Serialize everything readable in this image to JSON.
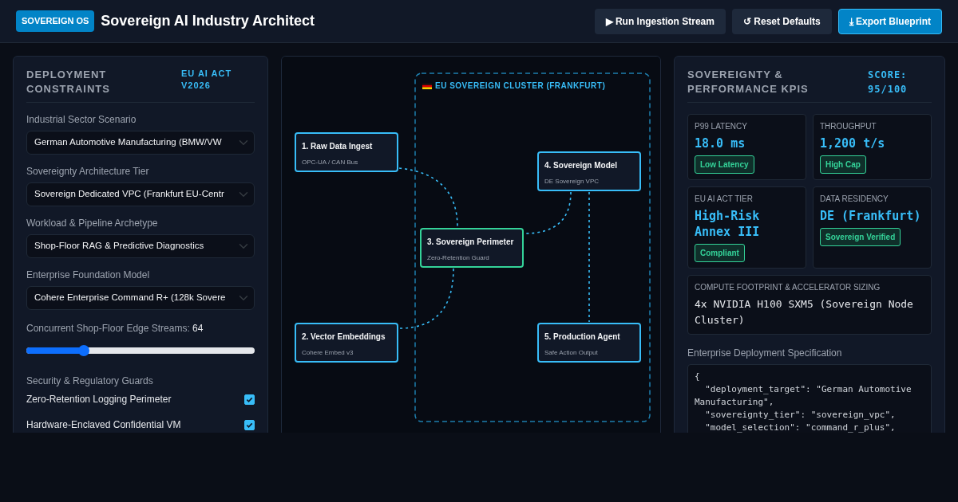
{
  "header": {
    "badge": "SOVEREIGN OS",
    "title": "Sovereign AI Industry Architect",
    "buttons": [
      {
        "label": "▶ Run Ingestion Stream",
        "kind": "secondary"
      },
      {
        "label": "↺ Reset Defaults",
        "kind": "secondary"
      },
      {
        "label": "⤓ Export Blueprint",
        "kind": "primary"
      }
    ]
  },
  "constraints": {
    "title": "DEPLOYMENT CONSTRAINTS",
    "tag": "EU AI ACT V2026",
    "selects": [
      {
        "label": "Industrial Sector Scenario",
        "value": "German Automotive Manufacturing (BMW/VW"
      },
      {
        "label": "Sovereignty Architecture Tier",
        "value": "Sovereign Dedicated VPC (Frankfurt EU-Centr"
      },
      {
        "label": "Workload & Pipeline Archetype",
        "value": "Shop-Floor RAG & Predictive Diagnostics"
      },
      {
        "label": "Enterprise Foundation Model",
        "value": "Cohere Enterprise Command R+ (128k Sovere"
      }
    ],
    "slider": {
      "label": "Concurrent Shop-Floor Edge Streams:",
      "reading": "64",
      "level": 0.25
    },
    "guards_title": "Security & Regulatory Guards",
    "guards": [
      {
        "label": "Zero-Retention Logging Perimeter",
        "checked": true
      },
      {
        "label": "Hardware-Enclaved Confidential VM",
        "checked": true
      }
    ]
  },
  "diagram": {
    "cluster": {
      "label": "EU SOVEREIGN CLUSTER (FRANKFURT)"
    },
    "nodes": [
      {
        "title": "1. Raw Data Ingest",
        "subtitle": "OPC-UA / CAN Bus",
        "color": "#38bdf8"
      },
      {
        "title": "2. Vector Embeddings",
        "subtitle": "Cohere Embed v3",
        "color": "#38bdf8"
      },
      {
        "title": "3. Sovereign Perimeter",
        "subtitle": "Zero-Retention Guard",
        "color": "#34d399"
      },
      {
        "title": "4. Sovereign Model",
        "subtitle": "DE Sovereign VPC",
        "color": "#38bdf8"
      },
      {
        "title": "5. Production Agent",
        "subtitle": "Safe Action Output",
        "color": "#38bdf8"
      }
    ]
  },
  "kpis": {
    "title": "SOVEREIGNTY & PERFORMANCE KPIS",
    "score": "SCORE: 95/100",
    "tiles": [
      {
        "label": "P99 LATENCY",
        "value": "18.0 ms",
        "badge": "Low Latency"
      },
      {
        "label": "THROUGHPUT",
        "value": "1,200 t/s",
        "badge": "High Cap"
      },
      {
        "label": "EU AI ACT TIER",
        "value": "High-Risk Annex III",
        "badge": "Compliant"
      },
      {
        "label": "DATA RESIDENCY",
        "value": "DE (Frankfurt)",
        "badge": "Sovereign Verified"
      }
    ],
    "compute": {
      "label": "COMPUTE FOOTPRINT & ACCELERATOR SIZING",
      "value": "4x NVIDIA H100 SXM5 (Sovereign Node Cluster)"
    },
    "spec_title": "Enterprise Deployment Specification",
    "spec_lines": [
      "{",
      "  \"deployment_target\": \"German Automotive Manufacturing\",",
      "  \"sovereignty_tier\": \"sovereign_vpc\",",
      "  \"model_selection\": \"command_r_plus\","
    ]
  }
}
